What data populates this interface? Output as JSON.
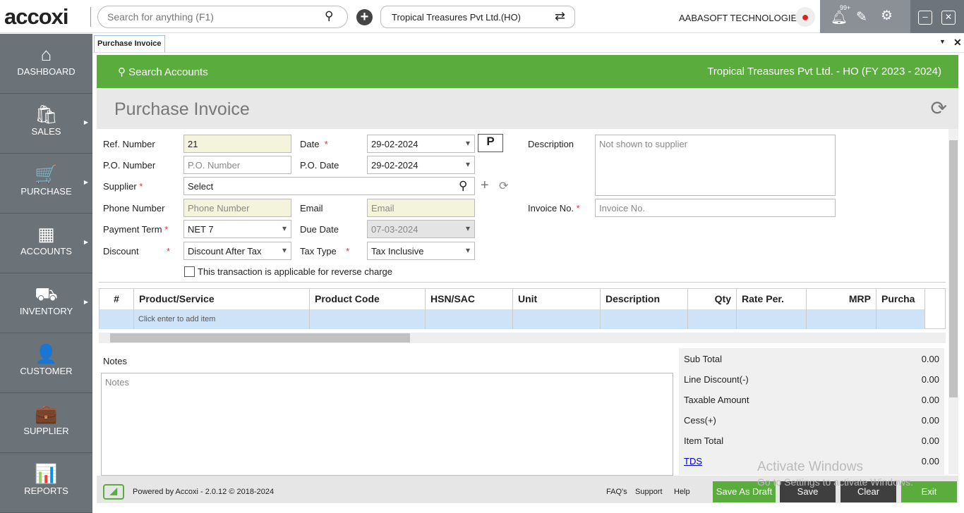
{
  "header": {
    "logo": "accoxi",
    "search_placeholder": "Search for anything (F1)",
    "company": "Tropical Treasures Pvt Ltd.(HO)",
    "org": "AABASOFT TECHNOLOGIES",
    "notif_count": "99+"
  },
  "sidebar": [
    {
      "label": "DASHBOARD",
      "icon": "⌂"
    },
    {
      "label": "SALES",
      "icon": "🛍"
    },
    {
      "label": "PURCHASE",
      "icon": "🛒"
    },
    {
      "label": "ACCOUNTS",
      "icon": "▦"
    },
    {
      "label": "INVENTORY",
      "icon": "⛟"
    },
    {
      "label": "CUSTOMER",
      "icon": "👤"
    },
    {
      "label": "SUPPLIER",
      "icon": "💼"
    },
    {
      "label": "REPORTS",
      "icon": "📊"
    }
  ],
  "tab": "Purchase Invoice",
  "bar": {
    "search": "Search Accounts",
    "company": "Tropical Treasures Pvt Ltd. - HO (FY 2023 - 2024)"
  },
  "title": "Purchase Invoice",
  "form": {
    "ref_label": "Ref. Number",
    "ref": "21",
    "date_label": "Date",
    "date": "29-02-2024",
    "desc_label": "Description",
    "desc_ph": "Not shown to supplier",
    "po_label": "P.O. Number",
    "po_ph": "P.O. Number",
    "podate_label": "P.O. Date",
    "podate": "29-02-2024",
    "supplier_label": "Supplier",
    "supplier": "Select",
    "phone_label": "Phone Number",
    "phone_ph": "Phone Number",
    "email_label": "Email",
    "email_ph": "Email",
    "invno_label": "Invoice No.",
    "invno_ph": "Invoice No.",
    "term_label": "Payment Term",
    "term": "NET 7",
    "due_label": "Due Date",
    "due": "07-03-2024",
    "disc_label": "Discount",
    "disc": "Discount After Tax",
    "taxtype_label": "Tax Type",
    "taxtype": "Tax Inclusive",
    "reverse": "This transaction is applicable for reverse charge",
    "req": "*"
  },
  "grid": {
    "columns": [
      "#",
      "Product/Service",
      "Product Code",
      "HSN/SAC",
      "Unit",
      "Description",
      "Qty",
      "Rate Per.",
      "MRP",
      "Purcha"
    ],
    "hint": "Click enter to add item"
  },
  "notes": {
    "label": "Notes",
    "ph": "Notes"
  },
  "totals": [
    {
      "label": "Sub Total",
      "value": "0.00"
    },
    {
      "label": "Line Discount(-)",
      "value": "0.00"
    },
    {
      "label": "Taxable Amount",
      "value": "0.00"
    },
    {
      "label": "Cess(+)",
      "value": "0.00"
    },
    {
      "label": "Item Total",
      "value": "0.00"
    },
    {
      "label": "TDS",
      "value": "0.00"
    }
  ],
  "footer": {
    "powered": "Powered by Accoxi - 2.0.12 © 2018-2024",
    "faq": "FAQ's",
    "support": "Support",
    "help": "Help",
    "draft": "Save As Draft",
    "save": "Save",
    "clear": "Clear",
    "exit": "Exit"
  },
  "watermark": {
    "line1": "Activate Windows",
    "line2": "Go to Settings to activate Windows."
  }
}
